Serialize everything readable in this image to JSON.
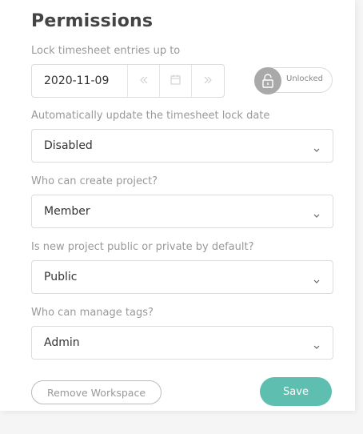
{
  "page": {
    "title": "Permissions"
  },
  "lock": {
    "label": "Lock timesheet entries up to",
    "date_value": "2020-11-09",
    "prev_icon": "double-chevron-left-icon",
    "calendar_icon": "calendar-icon",
    "next_icon": "double-chevron-right-icon",
    "toggle_label": "Unlocked",
    "toggle_icon": "unlock-icon"
  },
  "auto_update": {
    "label": "Automatically update the timesheet lock date",
    "value": "Disabled"
  },
  "create_project": {
    "label": "Who can create project?",
    "value": "Member"
  },
  "project_visibility": {
    "label": "Is new project public or private by default?",
    "value": "Public"
  },
  "manage_tags": {
    "label": "Who can manage tags?",
    "value": "Admin"
  },
  "actions": {
    "remove_label": "Remove Workspace",
    "save_label": "Save"
  },
  "colors": {
    "accent": "#5ebfb0",
    "toggle_knob": "#a9a9a9",
    "label": "#999999"
  }
}
